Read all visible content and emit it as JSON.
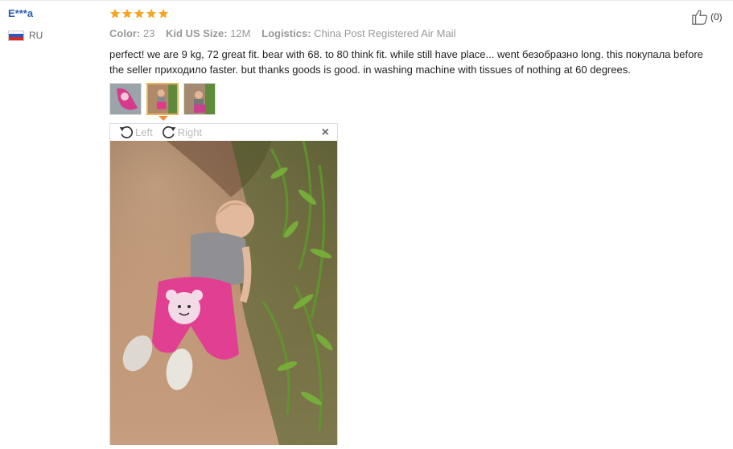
{
  "review": {
    "user_name": "E***a",
    "country_code": "RU",
    "rating": 5,
    "color_label": "Color:",
    "color_value": "23",
    "size_label": "Kid US Size:",
    "size_value": "12M",
    "logistics_label": "Logistics:",
    "logistics_value": "China Post Registered Air Mail",
    "text": "perfect! we are 9 kg, 72 great fit. bear with 68. to 80 think fit. while still have place... went безобразно long. this покупала before the seller приходило faster. but thanks goods is good. in washing machine with tissues of nothing at 60 degrees.",
    "like_count": "(0)"
  },
  "viewer": {
    "rotate_left_label": "Left",
    "rotate_right_label": "Right",
    "close_label": "×"
  },
  "thumbnails": [
    {
      "name": "photo-1"
    },
    {
      "name": "photo-2",
      "active": true
    },
    {
      "name": "photo-3"
    }
  ],
  "colors": {
    "star": "#f5a623",
    "user_name": "#2a5db0",
    "pointer": "#f08c3a"
  },
  "icons": [
    "star-icon",
    "rotate-left-icon",
    "rotate-right-icon",
    "close-icon",
    "thumbs-up-icon",
    "flag-icon"
  ]
}
